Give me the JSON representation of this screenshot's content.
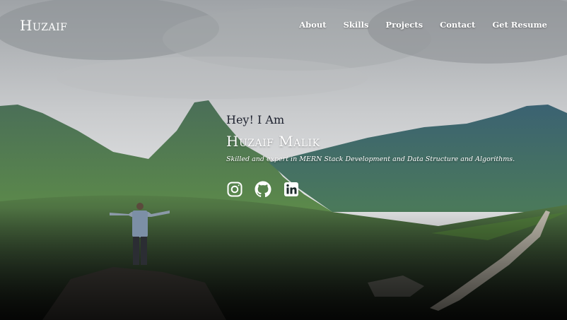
{
  "brand": {
    "logo_text": "Huzaif"
  },
  "nav": {
    "items": [
      {
        "label": "About"
      },
      {
        "label": "Skills"
      },
      {
        "label": "Projects"
      },
      {
        "label": "Contact"
      },
      {
        "label": "Get Resume"
      }
    ]
  },
  "hero": {
    "greeting": "Hey! I Am",
    "name": "Huzaif Malik",
    "tagline": "Skilled and expert in MERN Stack Development and Data Structure and Algorithms.",
    "socials": [
      {
        "name": "instagram-icon"
      },
      {
        "name": "github-icon"
      },
      {
        "name": "linkedin-icon"
      }
    ]
  },
  "colors": {
    "nav_text": "#ffffff",
    "greeting_text": "#1f2330",
    "sky": "#cfd1d3",
    "mountain": "#3f6a5c"
  }
}
